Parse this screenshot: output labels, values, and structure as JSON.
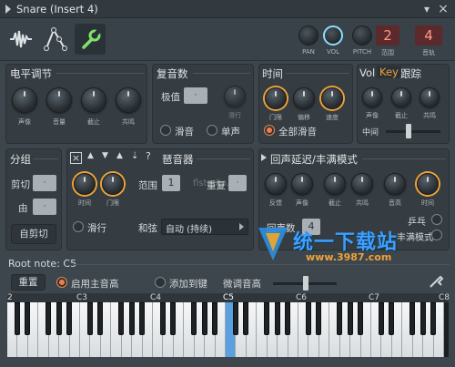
{
  "window": {
    "title": "Snare (Insert 4)",
    "menu_glyph": "▾",
    "close_glyph": "×"
  },
  "toolbar": {
    "labels": {
      "pan": "PAN",
      "vol": "VOL",
      "pitch": "PITCH",
      "track": "音轨"
    },
    "pitch_value": "2",
    "track_value": "4"
  },
  "levels": {
    "title": "电平调节",
    "knobs": [
      "声像",
      "音量",
      "截止",
      "共鸣"
    ]
  },
  "polyphony": {
    "title": "复音数",
    "max_label": "极值",
    "max_value": "·",
    "slide_knob_label": "滑行",
    "options": [
      "滑音",
      "单声"
    ]
  },
  "time": {
    "title": "时间",
    "knobs": [
      "门限",
      "偏移",
      "速度"
    ],
    "full_porta": "全部滑音"
  },
  "vkt": {
    "tabs": [
      "Vol",
      "Key",
      "跟踪"
    ],
    "active_tab": "Key",
    "knobs": [
      "声像",
      "截止",
      "共鸣"
    ],
    "center_label": "中间"
  },
  "group": {
    "title": "分组",
    "cut_label": "剪切",
    "by_label": "由",
    "cut_value": "·",
    "by_value": "·",
    "self_cut": "自剪切"
  },
  "arp": {
    "title": "琶音器",
    "controls": [
      "×",
      "▲",
      "▼",
      "▲",
      "⇣",
      "?"
    ],
    "knobs": [
      "时间",
      "门限"
    ],
    "range_label": "范围",
    "range_value": "1",
    "repeat_label": "重复",
    "repeat_value": "·",
    "slide_label": "滑行",
    "chord_label": "和弦",
    "chord_value": "自动 (持续)",
    "watermark": "flstudio.cn"
  },
  "echo": {
    "title": "回声延迟/丰满模式",
    "knobs": [
      "反馈",
      "声像",
      "截止",
      "共鸣",
      "音高",
      "时间"
    ],
    "count_label": "回声数",
    "count_value": "4",
    "ping_pong": "乒乓",
    "fat_mode": "丰满模式"
  },
  "bottom": {
    "root_note": "Root note: C5",
    "reset": "重置",
    "main_pitch": "启用主音高",
    "add_key": "添加到键",
    "fine_tune": "微调音高"
  },
  "piano": {
    "octave_labels": [
      "2",
      "C3",
      "C4",
      "C5",
      "C6",
      "C7",
      "C8"
    ],
    "root_key": "C5"
  },
  "watermark_site": {
    "name": "统一下载站",
    "url": "www.3987.com"
  }
}
